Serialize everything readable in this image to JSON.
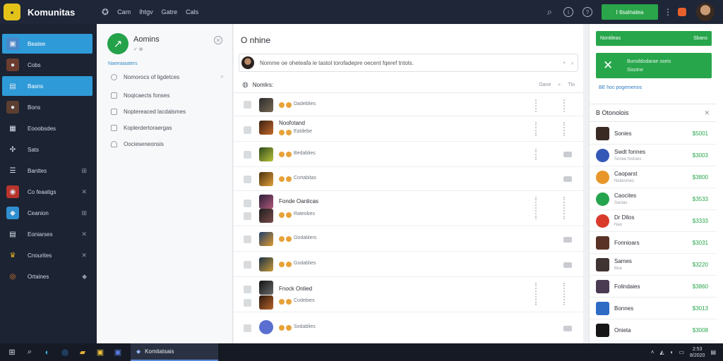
{
  "app": {
    "name": "Komunitas",
    "logo_glyph": "▪"
  },
  "topnav": {
    "items": [
      "Cam",
      "Ihtgv",
      "Gatre",
      "Cals"
    ]
  },
  "topbar": {
    "cta_label": "I tlsalnatea",
    "menu_glyph": "⋮"
  },
  "sidebar": {
    "items": [
      {
        "label": "Beatee",
        "active": true,
        "trail": ""
      },
      {
        "label": "Cobs",
        "active": false,
        "trail": ""
      },
      {
        "label": "Basns",
        "active": true,
        "trail": ""
      },
      {
        "label": "Bons",
        "active": false,
        "trail": ""
      },
      {
        "label": "Eooobsdes",
        "active": false,
        "trail": ""
      },
      {
        "label": "Sats",
        "active": false,
        "trail": ""
      },
      {
        "label": "Banttes",
        "active": false,
        "trail": "⊞"
      },
      {
        "label": "Co feaatigs",
        "active": false,
        "trail": "✕"
      },
      {
        "label": "Ceanion",
        "active": false,
        "trail": "⊞"
      },
      {
        "label": "Eoniarses",
        "active": false,
        "trail": "✕"
      },
      {
        "label": "Cnourites",
        "active": false,
        "trail": "✕"
      },
      {
        "label": "Ortaines",
        "active": false,
        "trail": "◆"
      }
    ]
  },
  "filters": {
    "title": "Aomins",
    "subtitle": "✓ ⊕",
    "section": "Naeeaiaaters",
    "options": [
      {
        "label": "Nomorocs of ligdetces",
        "trail": "⌕"
      },
      {
        "label": "Noqicaects fonses",
        "trail": ""
      },
      {
        "label": "Noptereaced lacdalsmes",
        "trail": ""
      },
      {
        "label": "Koplerdertoraergas",
        "trail": ""
      },
      {
        "label": "Oocieseneonsis",
        "trail": ""
      }
    ]
  },
  "main": {
    "heading": "O nhine",
    "compose_text": "Nomme oe oheteafa ie tastol torofadepre oecent fqeref tntols.",
    "list_label": "Nomlirs:",
    "list_right": [
      "Oane",
      "⌕",
      "Tlo"
    ],
    "rows": [
      {
        "title": "",
        "meta": "Dadeblies",
        "dots": true,
        "video": false
      },
      {
        "title": "Noofotand",
        "meta": "Eatdebe",
        "dots": true,
        "video": false
      },
      {
        "title": "",
        "meta": "Bedablies",
        "dots": true,
        "video": true
      },
      {
        "title": "",
        "meta": "Cortabitas",
        "dots": false,
        "video": true
      },
      {
        "title": "Fonde Oanlicas",
        "meta": "Rateobes",
        "dots": true,
        "video": false
      },
      {
        "title": "",
        "meta": "Oodablers",
        "dots": false,
        "video": true
      },
      {
        "title": "",
        "meta": "Godablies",
        "dots": false,
        "video": true
      },
      {
        "title": "Fnock Onlied",
        "meta": "Codebies",
        "dots": true,
        "video": false
      },
      {
        "title": "",
        "meta": "Sodablies",
        "dots": false,
        "video": true
      }
    ]
  },
  "rail": {
    "banner_left": "Nontileas",
    "banner_right": "Sbans",
    "promo_line1": "Buroddodarae sseis",
    "promo_line2": "Sisoine",
    "link": "BE hoc pogemenos",
    "card_title": "B Otonolois",
    "leaders": [
      {
        "name": "Sonies",
        "sub": "",
        "value": "$5001",
        "color": "#3a2a24"
      },
      {
        "name": "Swdt fonnes",
        "sub": "Sonee fostoes",
        "value": "$3003",
        "color": "#3458b5"
      },
      {
        "name": "Caoparst",
        "sub": "Nsitesmes",
        "value": "$3800",
        "color": "#e8962a"
      },
      {
        "name": "Caocites",
        "sub": "Sanias",
        "value": "$3533",
        "color": "#24a44c"
      },
      {
        "name": "Dr Dllos",
        "sub": "Nao",
        "value": "$3333",
        "color": "#d93b2b"
      },
      {
        "name": "Fonnioars",
        "sub": "",
        "value": "$3031",
        "color": "#5a3326"
      },
      {
        "name": "Sames",
        "sub": "Boa",
        "value": "$3220",
        "color": "#3f3431"
      },
      {
        "name": "Folindaies",
        "sub": "",
        "value": "$3860",
        "color": "#4a3a52"
      },
      {
        "name": "Bonnes",
        "sub": "",
        "value": "$3013",
        "color": "#2d6bc4"
      },
      {
        "name": "Onieta",
        "sub": "",
        "value": "$3008",
        "color": "#161616"
      }
    ]
  },
  "taskbar": {
    "active_label": "Komitatsais",
    "time": "2:53",
    "date": "8/2020"
  }
}
